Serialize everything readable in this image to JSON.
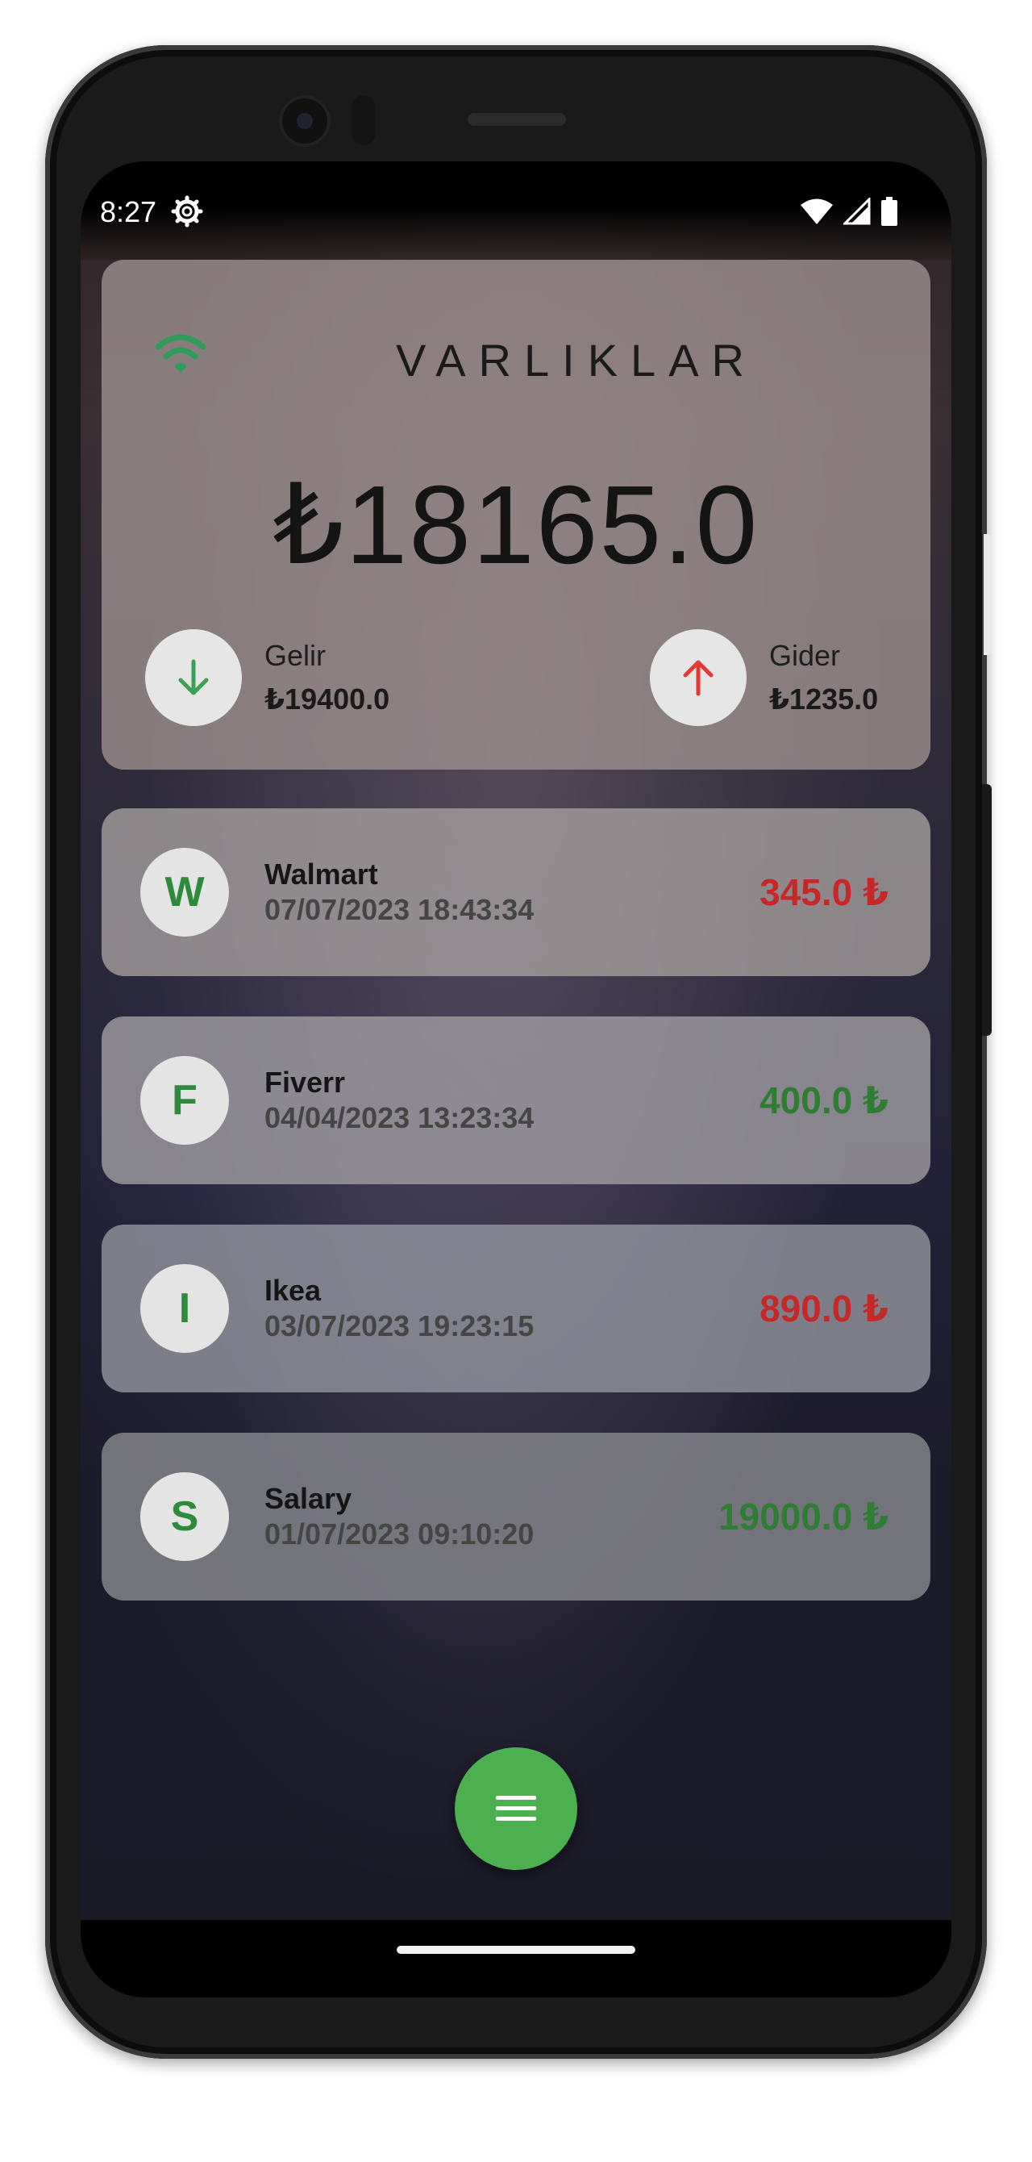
{
  "status_bar": {
    "time": "8:27",
    "icons": [
      "gear-icon",
      "wifi-icon",
      "signal-icon",
      "battery-icon"
    ]
  },
  "summary": {
    "title": "VARLIKLAR",
    "total": "₺18165.0",
    "income": {
      "label": "Gelir",
      "value": "₺19400.0",
      "icon": "arrow-down-icon"
    },
    "expense": {
      "label": "Gider",
      "value": "₺1235.0",
      "icon": "arrow-up-icon"
    },
    "connection_icon": "wifi-icon"
  },
  "transactions": [
    {
      "initial": "W",
      "name": "Walmart",
      "date": "07/07/2023 18:43:34",
      "amount": "345.0 ₺",
      "kind": "expense"
    },
    {
      "initial": "F",
      "name": "Fiverr",
      "date": "04/04/2023 13:23:34",
      "amount": "400.0 ₺",
      "kind": "income"
    },
    {
      "initial": "I",
      "name": "Ikea",
      "date": "03/07/2023 19:23:15",
      "amount": "890.0 ₺",
      "kind": "expense"
    },
    {
      "initial": "S",
      "name": "Salary",
      "date": "01/07/2023 09:10:20",
      "amount": "19000.0 ₺",
      "kind": "income"
    }
  ],
  "fab": {
    "icon": "menu-icon"
  },
  "colors": {
    "income": "#2e7d32",
    "expense": "#c62828",
    "accent": "#4caf50",
    "wifi": "#2e9b5a",
    "arrow_down": "#3aa152",
    "arrow_up": "#e53935"
  }
}
